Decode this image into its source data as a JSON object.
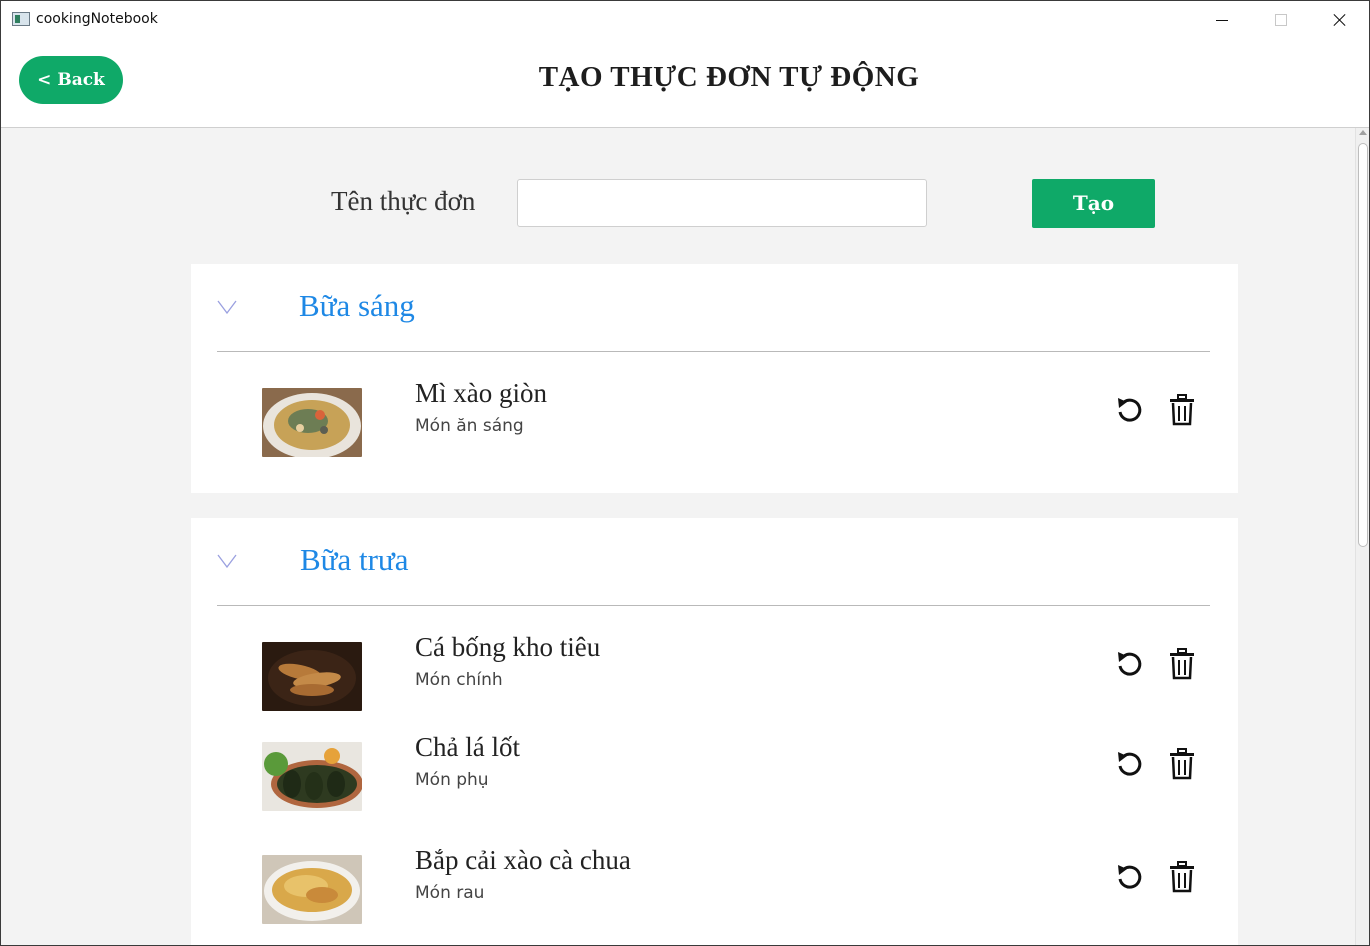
{
  "window": {
    "title": "cookingNotebook"
  },
  "header": {
    "back_label": "< Back",
    "title": "TẠO THỰC ĐƠN TỰ ĐỘNG"
  },
  "form": {
    "menu_name_label": "Tên thực đơn",
    "menu_name_value": "",
    "menu_name_placeholder": "",
    "create_label": "Tạo"
  },
  "meals": [
    {
      "title": "Bữa sáng",
      "dishes": [
        {
          "name": "Mì xào giòn",
          "type": "Món ăn sáng",
          "image": "fried-noodle-photo"
        }
      ]
    },
    {
      "title": "Bữa trưa",
      "dishes": [
        {
          "name": "Cá bống kho tiêu",
          "type": "Món chính",
          "image": "braised-fish-photo"
        },
        {
          "name": "Chả lá lốt",
          "type": "Món phụ",
          "image": "betel-leaf-rolls-photo"
        },
        {
          "name": "Bắp cải xào cà chua",
          "type": "Món rau",
          "image": "cabbage-tomato-photo"
        }
      ]
    }
  ],
  "icons": {
    "refresh": "refresh-icon",
    "delete": "trash-icon",
    "expand": "chevron-down-icon"
  },
  "colors": {
    "accent": "#0fa968",
    "meal_title": "#1e88e5",
    "chevron": "#9aa0e0"
  }
}
